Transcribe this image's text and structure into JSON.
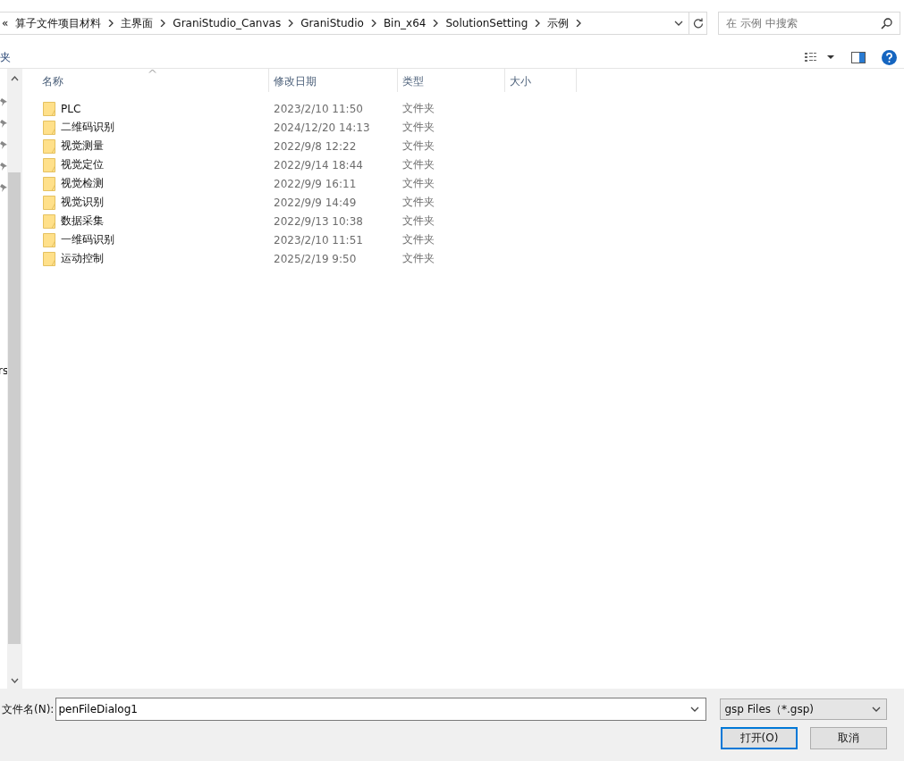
{
  "address_bar": {
    "overflow": "«",
    "crumbs": [
      "算子文件项目材料",
      "主界面",
      "GraniStudio_Canvas",
      "GraniStudio",
      "Bin_x64",
      "SolutionSetting",
      "示例"
    ]
  },
  "search": {
    "placeholder": "在 示例 中搜索"
  },
  "toolbar": {
    "label": "夹"
  },
  "nav_pane": {
    "texts": [
      "rs"
    ]
  },
  "table": {
    "columns": [
      {
        "label": "名称",
        "sorted": true
      },
      {
        "label": "修改日期",
        "sorted": false
      },
      {
        "label": "类型",
        "sorted": false
      },
      {
        "label": "大小",
        "sorted": false
      }
    ],
    "rows": [
      {
        "name": "PLC",
        "date": "2023/2/10 11:50",
        "type": "文件夹"
      },
      {
        "name": "二维码识别",
        "date": "2024/12/20 14:13",
        "type": "文件夹"
      },
      {
        "name": "视觉测量",
        "date": "2022/9/8 12:22",
        "type": "文件夹"
      },
      {
        "name": "视觉定位",
        "date": "2022/9/14 18:44",
        "type": "文件夹"
      },
      {
        "name": "视觉检测",
        "date": "2022/9/9 16:11",
        "type": "文件夹"
      },
      {
        "name": "视觉识别",
        "date": "2022/9/9 14:49",
        "type": "文件夹"
      },
      {
        "name": "数据采集",
        "date": "2022/9/13 10:38",
        "type": "文件夹"
      },
      {
        "name": "一维码识别",
        "date": "2023/2/10 11:51",
        "type": "文件夹"
      },
      {
        "name": "运动控制",
        "date": "2025/2/19 9:50",
        "type": "文件夹"
      }
    ]
  },
  "filename": {
    "label": "文件名(N):",
    "value": "penFileDialog1"
  },
  "filter": {
    "value": "gsp Files（*.gsp)"
  },
  "buttons": [
    {
      "label": "打开(O)",
      "default": true
    },
    {
      "label": "取消",
      "default": false
    }
  ]
}
